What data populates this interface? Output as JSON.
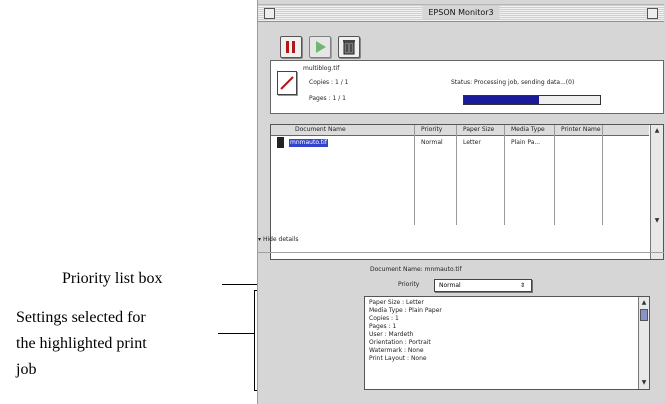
{
  "callouts": {
    "priority": "Priority list box",
    "settings_line1": "Settings selected for",
    "settings_line2": "the highlighted print",
    "settings_line3": "job"
  },
  "window": {
    "title": "EPSON Monitor3"
  },
  "toolbar": {
    "pause_icon": "pause-icon",
    "resume_icon": "play-icon",
    "delete_icon": "trash-icon"
  },
  "job": {
    "name": "multiblog.tif",
    "copies": "Copies : 1 / 1",
    "pages": "Pages : 1 / 1",
    "status": "Status: Processing job, sending data...(0)",
    "progress": 0.55
  },
  "table": {
    "headers": [
      "Document Name",
      "Priority",
      "Paper Size",
      "Media Type",
      "Printer Name"
    ],
    "rows": [
      {
        "document": "mnmauto.tif",
        "priority": "Normal",
        "paper": "Letter",
        "media": "Plain Pa..."
      }
    ]
  },
  "details": {
    "toggle": "Hide details",
    "document_name": "Document Name: mnmauto.tif",
    "priority_label": "Priority",
    "priority_value": "Normal",
    "settings": [
      "Paper Size : Letter",
      "Media Type : Plain Paper",
      "Copies : 1",
      "Pages : 1",
      "User : Mardeth",
      "Orientation : Portrait",
      "Watermark : None",
      "Print Layout : None"
    ]
  },
  "colors": {
    "progress_fill": "#1b1b9a",
    "selection": "#3344cc",
    "pause_red": "#b01818",
    "play_green": "#3ba83b"
  }
}
